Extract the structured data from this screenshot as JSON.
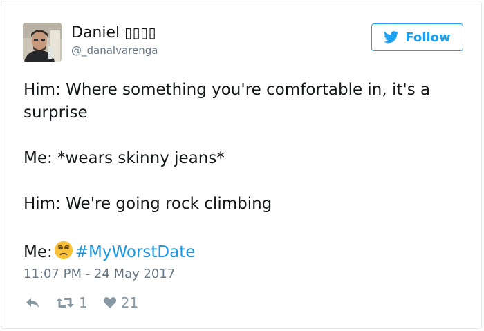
{
  "author": {
    "display_name": "Daniel ",
    "name_emoji_placeholder": "▯▯▯▯",
    "handle": "@_danalvarenga"
  },
  "follow_button": {
    "label": "Follow"
  },
  "tweet": {
    "line1": "Him: Where something you're comfortable in, it's a",
    "line2": "surprise",
    "line3": "Me: *wears skinny jeans*",
    "line4": "Him: We're going rock climbing",
    "line5_prefix": "Me:",
    "hashtag": "#MyWorstDate",
    "timestamp": "11:07 PM - 24 May 2017"
  },
  "stats": {
    "retweets": "1",
    "likes": "21"
  },
  "colors": {
    "brand_blue": "#1da1f2",
    "link_blue": "#1b95e0",
    "secondary_text": "#657786",
    "icon_gray": "#8899a6"
  },
  "icons": {
    "follow": "twitter-bird-icon",
    "reply": "reply-icon",
    "retweet": "retweet-icon",
    "like": "heart-icon",
    "tweet_emoji": "unamused-face-emoji"
  }
}
